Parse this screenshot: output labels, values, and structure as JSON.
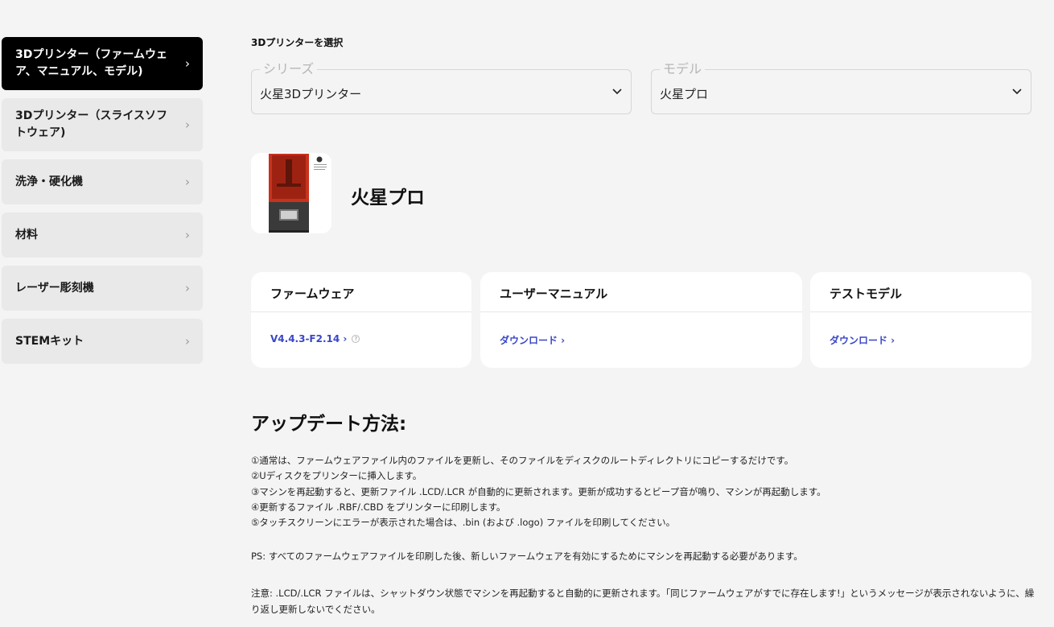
{
  "sidebar": {
    "items": [
      {
        "label": "3Dプリンター（ファームウェア、マニュアル、モデル)",
        "active": true
      },
      {
        "label": "3Dプリンター（スライスソフトウェア)"
      },
      {
        "label": "洗浄・硬化機"
      },
      {
        "label": "材料"
      },
      {
        "label": "レーザー彫刻機"
      },
      {
        "label": "STEMキット"
      }
    ],
    "chevron": "›"
  },
  "selector": {
    "title": "3Dプリンターを選択",
    "series": {
      "legend": "シリーズ",
      "value": "火星3Dプリンター"
    },
    "model": {
      "legend": "モデル",
      "value": "火星プロ"
    }
  },
  "product": {
    "name": "火星プロ"
  },
  "cards": [
    {
      "title": "ファームウェア",
      "link": "V4.4.3-F2.14 ›",
      "info": "?"
    },
    {
      "title": "ユーザーマニュアル",
      "link": "ダウンロード ›"
    },
    {
      "title": "テストモデル",
      "link": "ダウンロード ›"
    }
  ],
  "update": {
    "heading": "アップデート方法:",
    "steps": [
      "①通常は、ファームウェアファイル内のファイルを更新し、そのファイルをディスクのルートディレクトリにコピーするだけです。",
      "②Uディスクをプリンターに挿入します。",
      "③マシンを再起動すると、更新ファイル .LCD/.LCR が自動的に更新されます。更新が成功するとビープ音が鳴り、マシンが再起動します。",
      "④更新するファイル .RBF/.CBD をプリンターに印刷します。",
      "⑤タッチスクリーンにエラーが表示された場合は、.bin (および .logo) ファイルを印刷してください。"
    ],
    "ps": "PS: すべてのファームウェアファイルを印刷した後、新しいファームウェアを有効にするためにマシンを再起動する必要があります。",
    "note": "注意: .LCD/.LCR ファイルは、シャットダウン状態でマシンを再起動すると自動的に更新されます。「同じファームウェアがすでに存在します!」というメッセージが表示されないように、繰り返し更新しないでください。"
  },
  "colors": {
    "link": "#3946c9",
    "active_bg": "#000000",
    "page_bg": "#f4f4f4"
  }
}
